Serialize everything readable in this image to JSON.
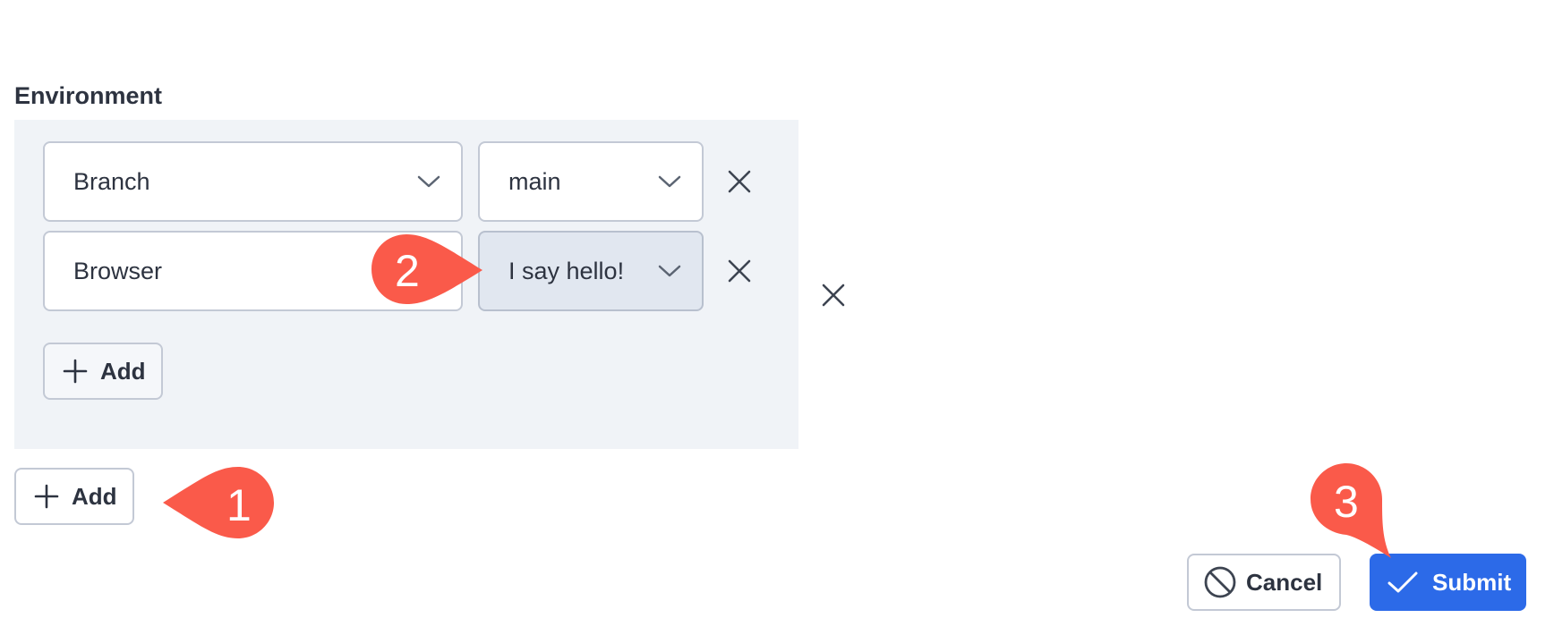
{
  "environment": {
    "label": "Environment",
    "rows": [
      {
        "key": "Branch",
        "value": "main"
      },
      {
        "key": "Browser",
        "value": "I say hello!"
      }
    ],
    "inner_add_label": "Add"
  },
  "outer_add_label": "Add",
  "actions": {
    "cancel_label": "Cancel",
    "submit_label": "Submit"
  },
  "callouts": [
    "1",
    "2",
    "3"
  ],
  "colors": {
    "accent": "#2c6ae8",
    "callout": "#fa5a4a",
    "panel_bg": "#f0f3f7",
    "active_select_bg": "#e1e7f0"
  }
}
